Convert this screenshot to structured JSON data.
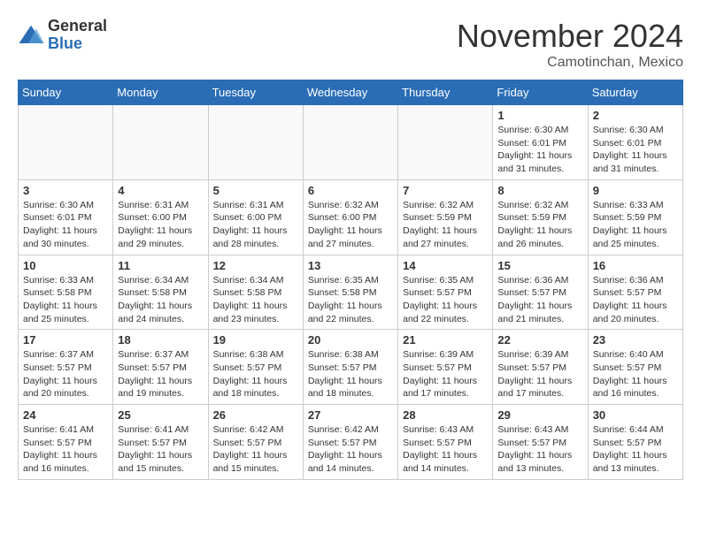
{
  "header": {
    "logo": {
      "general": "General",
      "blue": "Blue"
    },
    "title": "November 2024",
    "location": "Camotinchan, Mexico"
  },
  "calendar": {
    "days_of_week": [
      "Sunday",
      "Monday",
      "Tuesday",
      "Wednesday",
      "Thursday",
      "Friday",
      "Saturday"
    ],
    "weeks": [
      [
        {
          "day": "",
          "info": ""
        },
        {
          "day": "",
          "info": ""
        },
        {
          "day": "",
          "info": ""
        },
        {
          "day": "",
          "info": ""
        },
        {
          "day": "",
          "info": ""
        },
        {
          "day": "1",
          "info": "Sunrise: 6:30 AM\nSunset: 6:01 PM\nDaylight: 11 hours and 31 minutes."
        },
        {
          "day": "2",
          "info": "Sunrise: 6:30 AM\nSunset: 6:01 PM\nDaylight: 11 hours and 31 minutes."
        }
      ],
      [
        {
          "day": "3",
          "info": "Sunrise: 6:30 AM\nSunset: 6:01 PM\nDaylight: 11 hours and 30 minutes."
        },
        {
          "day": "4",
          "info": "Sunrise: 6:31 AM\nSunset: 6:00 PM\nDaylight: 11 hours and 29 minutes."
        },
        {
          "day": "5",
          "info": "Sunrise: 6:31 AM\nSunset: 6:00 PM\nDaylight: 11 hours and 28 minutes."
        },
        {
          "day": "6",
          "info": "Sunrise: 6:32 AM\nSunset: 6:00 PM\nDaylight: 11 hours and 27 minutes."
        },
        {
          "day": "7",
          "info": "Sunrise: 6:32 AM\nSunset: 5:59 PM\nDaylight: 11 hours and 27 minutes."
        },
        {
          "day": "8",
          "info": "Sunrise: 6:32 AM\nSunset: 5:59 PM\nDaylight: 11 hours and 26 minutes."
        },
        {
          "day": "9",
          "info": "Sunrise: 6:33 AM\nSunset: 5:59 PM\nDaylight: 11 hours and 25 minutes."
        }
      ],
      [
        {
          "day": "10",
          "info": "Sunrise: 6:33 AM\nSunset: 5:58 PM\nDaylight: 11 hours and 25 minutes."
        },
        {
          "day": "11",
          "info": "Sunrise: 6:34 AM\nSunset: 5:58 PM\nDaylight: 11 hours and 24 minutes."
        },
        {
          "day": "12",
          "info": "Sunrise: 6:34 AM\nSunset: 5:58 PM\nDaylight: 11 hours and 23 minutes."
        },
        {
          "day": "13",
          "info": "Sunrise: 6:35 AM\nSunset: 5:58 PM\nDaylight: 11 hours and 22 minutes."
        },
        {
          "day": "14",
          "info": "Sunrise: 6:35 AM\nSunset: 5:57 PM\nDaylight: 11 hours and 22 minutes."
        },
        {
          "day": "15",
          "info": "Sunrise: 6:36 AM\nSunset: 5:57 PM\nDaylight: 11 hours and 21 minutes."
        },
        {
          "day": "16",
          "info": "Sunrise: 6:36 AM\nSunset: 5:57 PM\nDaylight: 11 hours and 20 minutes."
        }
      ],
      [
        {
          "day": "17",
          "info": "Sunrise: 6:37 AM\nSunset: 5:57 PM\nDaylight: 11 hours and 20 minutes."
        },
        {
          "day": "18",
          "info": "Sunrise: 6:37 AM\nSunset: 5:57 PM\nDaylight: 11 hours and 19 minutes."
        },
        {
          "day": "19",
          "info": "Sunrise: 6:38 AM\nSunset: 5:57 PM\nDaylight: 11 hours and 18 minutes."
        },
        {
          "day": "20",
          "info": "Sunrise: 6:38 AM\nSunset: 5:57 PM\nDaylight: 11 hours and 18 minutes."
        },
        {
          "day": "21",
          "info": "Sunrise: 6:39 AM\nSunset: 5:57 PM\nDaylight: 11 hours and 17 minutes."
        },
        {
          "day": "22",
          "info": "Sunrise: 6:39 AM\nSunset: 5:57 PM\nDaylight: 11 hours and 17 minutes."
        },
        {
          "day": "23",
          "info": "Sunrise: 6:40 AM\nSunset: 5:57 PM\nDaylight: 11 hours and 16 minutes."
        }
      ],
      [
        {
          "day": "24",
          "info": "Sunrise: 6:41 AM\nSunset: 5:57 PM\nDaylight: 11 hours and 16 minutes."
        },
        {
          "day": "25",
          "info": "Sunrise: 6:41 AM\nSunset: 5:57 PM\nDaylight: 11 hours and 15 minutes."
        },
        {
          "day": "26",
          "info": "Sunrise: 6:42 AM\nSunset: 5:57 PM\nDaylight: 11 hours and 15 minutes."
        },
        {
          "day": "27",
          "info": "Sunrise: 6:42 AM\nSunset: 5:57 PM\nDaylight: 11 hours and 14 minutes."
        },
        {
          "day": "28",
          "info": "Sunrise: 6:43 AM\nSunset: 5:57 PM\nDaylight: 11 hours and 14 minutes."
        },
        {
          "day": "29",
          "info": "Sunrise: 6:43 AM\nSunset: 5:57 PM\nDaylight: 11 hours and 13 minutes."
        },
        {
          "day": "30",
          "info": "Sunrise: 6:44 AM\nSunset: 5:57 PM\nDaylight: 11 hours and 13 minutes."
        }
      ]
    ]
  }
}
